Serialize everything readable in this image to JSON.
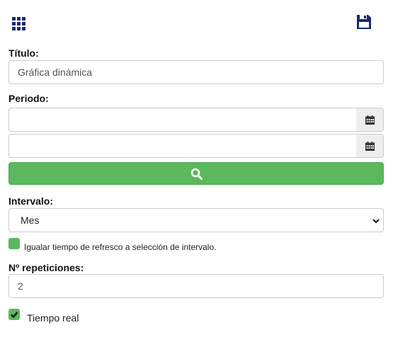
{
  "toolbar": {
    "grid_icon": "grid-icon",
    "save_icon": "floppy-disk-icon",
    "icon_color": "#1a2a6c"
  },
  "form": {
    "title_label": "Título:",
    "title_value": "Gráfica dinámica",
    "period_label": "Periodo:",
    "period_start_value": "",
    "period_end_value": "",
    "calendar_icon": "calendar-icon",
    "search_icon": "search-icon",
    "search_button_color": "#5cb85c",
    "interval_label": "Intervalo:",
    "interval_selected": "Mes",
    "sync_refresh_label": "Igualar tiempo de refresco a selección de intervalo.",
    "sync_refresh_checked": false,
    "repetitions_label": "Nº repeticiones:",
    "repetitions_value": "2",
    "realtime_label": "Tiempo real",
    "realtime_checked": true,
    "accent_color": "#5cb85c"
  }
}
